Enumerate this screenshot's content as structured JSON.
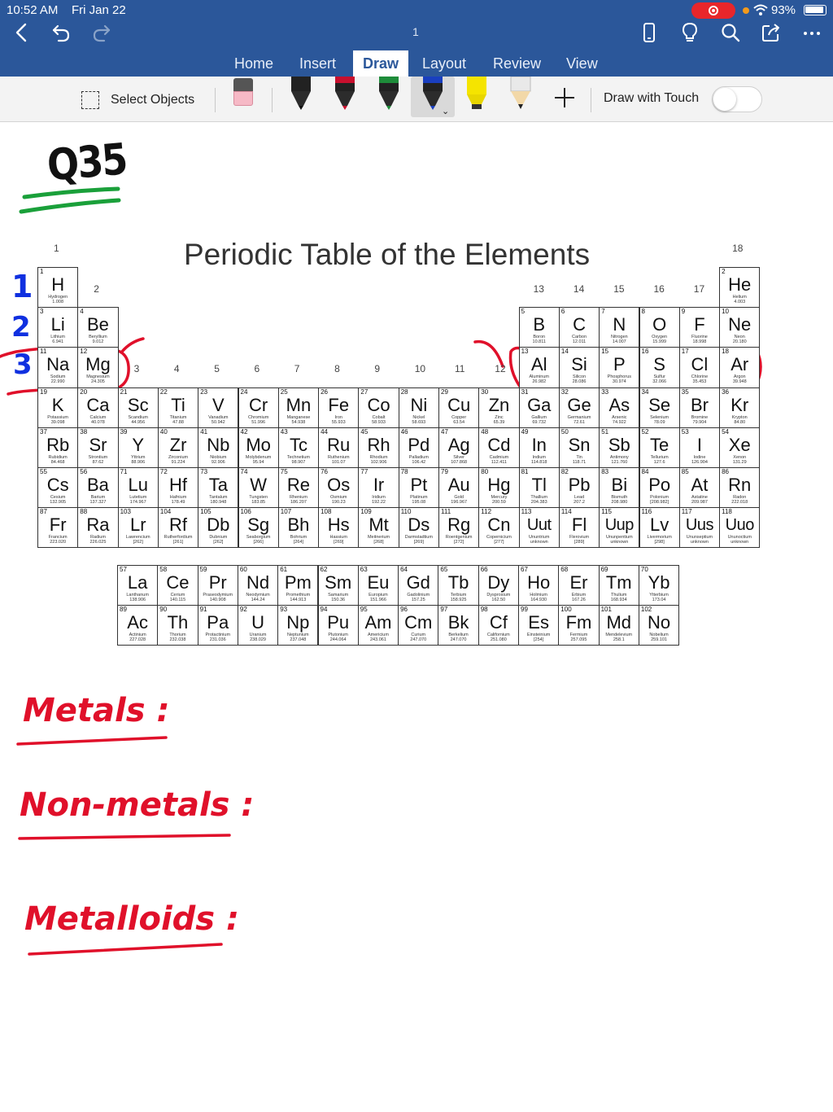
{
  "status_bar": {
    "time": "10:52 AM",
    "date": "Fri Jan 22",
    "battery": "93%"
  },
  "toolbar": {
    "page_number": "1"
  },
  "tabs": [
    {
      "label": "Home"
    },
    {
      "label": "Insert"
    },
    {
      "label": "Draw"
    },
    {
      "label": "Layout"
    },
    {
      "label": "Review"
    },
    {
      "label": "View"
    }
  ],
  "ribbon": {
    "select_objects_label": "Select Objects",
    "draw_with_touch_label": "Draw with Touch",
    "pens": [
      {
        "name": "black-pen",
        "color": "#1a1a1a"
      },
      {
        "name": "red-pen",
        "color": "#c8102e"
      },
      {
        "name": "green-pen",
        "color": "#1e8c3a"
      },
      {
        "name": "blue-pen",
        "color": "#1a3fbf"
      },
      {
        "name": "yellow-highlighter",
        "color": "#f5e400"
      },
      {
        "name": "pencil",
        "color": "#222222"
      }
    ]
  },
  "document": {
    "question_label": "Q35",
    "table_title": "Periodic Table of the Elements",
    "group_numbers": [
      "1",
      "2",
      "3",
      "4",
      "5",
      "6",
      "7",
      "8",
      "9",
      "10",
      "11",
      "12",
      "13",
      "14",
      "15",
      "16",
      "17",
      "18"
    ],
    "period_annotations": [
      "1",
      "2",
      "3"
    ],
    "categories": [
      "Metals :",
      "Non-metals :",
      "Metalloids :"
    ],
    "colors": {
      "accent": "#2b579a",
      "ink_red": "#e0102a",
      "ink_blue": "#1030e0",
      "ink_green": "#1aa03a"
    }
  },
  "elements": [
    {
      "n": "1",
      "s": "H",
      "name": "Hydrogen",
      "m": "1.008",
      "col": 1,
      "row": 1
    },
    {
      "n": "2",
      "s": "He",
      "name": "Helium",
      "m": "4.003",
      "col": 18,
      "row": 1
    },
    {
      "n": "3",
      "s": "Li",
      "name": "Lithium",
      "m": "6.941",
      "col": 1,
      "row": 2
    },
    {
      "n": "4",
      "s": "Be",
      "name": "Beryllium",
      "m": "9.012",
      "col": 2,
      "row": 2
    },
    {
      "n": "5",
      "s": "B",
      "name": "Boron",
      "m": "10.811",
      "col": 13,
      "row": 2
    },
    {
      "n": "6",
      "s": "C",
      "name": "Carbon",
      "m": "12.011",
      "col": 14,
      "row": 2
    },
    {
      "n": "7",
      "s": "N",
      "name": "Nitrogen",
      "m": "14.007",
      "col": 15,
      "row": 2
    },
    {
      "n": "8",
      "s": "O",
      "name": "Oxygen",
      "m": "15.999",
      "col": 16,
      "row": 2
    },
    {
      "n": "9",
      "s": "F",
      "name": "Fluorine",
      "m": "18.998",
      "col": 17,
      "row": 2
    },
    {
      "n": "10",
      "s": "Ne",
      "name": "Neon",
      "m": "20.180",
      "col": 18,
      "row": 2
    },
    {
      "n": "11",
      "s": "Na",
      "name": "Sodium",
      "m": "22.990",
      "col": 1,
      "row": 3
    },
    {
      "n": "12",
      "s": "Mg",
      "name": "Magnesium",
      "m": "24.305",
      "col": 2,
      "row": 3
    },
    {
      "n": "13",
      "s": "Al",
      "name": "Aluminum",
      "m": "26.982",
      "col": 13,
      "row": 3
    },
    {
      "n": "14",
      "s": "Si",
      "name": "Silicon",
      "m": "28.086",
      "col": 14,
      "row": 3
    },
    {
      "n": "15",
      "s": "P",
      "name": "Phosphorus",
      "m": "30.974",
      "col": 15,
      "row": 3
    },
    {
      "n": "16",
      "s": "S",
      "name": "Sulfur",
      "m": "32.066",
      "col": 16,
      "row": 3
    },
    {
      "n": "17",
      "s": "Cl",
      "name": "Chlorine",
      "m": "35.453",
      "col": 17,
      "row": 3
    },
    {
      "n": "18",
      "s": "Ar",
      "name": "Argon",
      "m": "39.948",
      "col": 18,
      "row": 3
    },
    {
      "n": "19",
      "s": "K",
      "name": "Potassium",
      "m": "39.098",
      "col": 1,
      "row": 4
    },
    {
      "n": "20",
      "s": "Ca",
      "name": "Calcium",
      "m": "40.078",
      "col": 2,
      "row": 4
    },
    {
      "n": "21",
      "s": "Sc",
      "name": "Scandium",
      "m": "44.956",
      "col": 3,
      "row": 4
    },
    {
      "n": "22",
      "s": "Ti",
      "name": "Titanium",
      "m": "47.88",
      "col": 4,
      "row": 4
    },
    {
      "n": "23",
      "s": "V",
      "name": "Vanadium",
      "m": "50.942",
      "col": 5,
      "row": 4
    },
    {
      "n": "24",
      "s": "Cr",
      "name": "Chromium",
      "m": "51.996",
      "col": 6,
      "row": 4
    },
    {
      "n": "25",
      "s": "Mn",
      "name": "Manganese",
      "m": "54.938",
      "col": 7,
      "row": 4
    },
    {
      "n": "26",
      "s": "Fe",
      "name": "Iron",
      "m": "55.933",
      "col": 8,
      "row": 4
    },
    {
      "n": "27",
      "s": "Co",
      "name": "Cobalt",
      "m": "58.933",
      "col": 9,
      "row": 4
    },
    {
      "n": "28",
      "s": "Ni",
      "name": "Nickel",
      "m": "58.693",
      "col": 10,
      "row": 4
    },
    {
      "n": "29",
      "s": "Cu",
      "name": "Copper",
      "m": "63.54",
      "col": 11,
      "row": 4
    },
    {
      "n": "30",
      "s": "Zn",
      "name": "Zinc",
      "m": "65.39",
      "col": 12,
      "row": 4
    },
    {
      "n": "31",
      "s": "Ga",
      "name": "Gallium",
      "m": "69.732",
      "col": 13,
      "row": 4
    },
    {
      "n": "32",
      "s": "Ge",
      "name": "Germanium",
      "m": "72.61",
      "col": 14,
      "row": 4
    },
    {
      "n": "33",
      "s": "As",
      "name": "Arsenic",
      "m": "74.922",
      "col": 15,
      "row": 4
    },
    {
      "n": "34",
      "s": "Se",
      "name": "Selenium",
      "m": "78.09",
      "col": 16,
      "row": 4
    },
    {
      "n": "35",
      "s": "Br",
      "name": "Bromine",
      "m": "79.904",
      "col": 17,
      "row": 4
    },
    {
      "n": "36",
      "s": "Kr",
      "name": "Krypton",
      "m": "84.80",
      "col": 18,
      "row": 4
    },
    {
      "n": "37",
      "s": "Rb",
      "name": "Rubidium",
      "m": "84.468",
      "col": 1,
      "row": 5
    },
    {
      "n": "38",
      "s": "Sr",
      "name": "Strontium",
      "m": "87.62",
      "col": 2,
      "row": 5
    },
    {
      "n": "39",
      "s": "Y",
      "name": "Yttrium",
      "m": "88.906",
      "col": 3,
      "row": 5
    },
    {
      "n": "40",
      "s": "Zr",
      "name": "Zirconium",
      "m": "91.224",
      "col": 4,
      "row": 5
    },
    {
      "n": "41",
      "s": "Nb",
      "name": "Niobium",
      "m": "92.906",
      "col": 5,
      "row": 5
    },
    {
      "n": "42",
      "s": "Mo",
      "name": "Molybdenum",
      "m": "95.94",
      "col": 6,
      "row": 5
    },
    {
      "n": "43",
      "s": "Tc",
      "name": "Technetium",
      "m": "98.907",
      "col": 7,
      "row": 5
    },
    {
      "n": "44",
      "s": "Ru",
      "name": "Ruthenium",
      "m": "101.07",
      "col": 8,
      "row": 5
    },
    {
      "n": "45",
      "s": "Rh",
      "name": "Rhodium",
      "m": "102.906",
      "col": 9,
      "row": 5
    },
    {
      "n": "46",
      "s": "Pd",
      "name": "Palladium",
      "m": "106.42",
      "col": 10,
      "row": 5
    },
    {
      "n": "47",
      "s": "Ag",
      "name": "Silver",
      "m": "107.868",
      "col": 11,
      "row": 5
    },
    {
      "n": "48",
      "s": "Cd",
      "name": "Cadmium",
      "m": "112.411",
      "col": 12,
      "row": 5
    },
    {
      "n": "49",
      "s": "In",
      "name": "Indium",
      "m": "114.818",
      "col": 13,
      "row": 5
    },
    {
      "n": "50",
      "s": "Sn",
      "name": "Tin",
      "m": "118.71",
      "col": 14,
      "row": 5
    },
    {
      "n": "51",
      "s": "Sb",
      "name": "Antimony",
      "m": "121.760",
      "col": 15,
      "row": 5
    },
    {
      "n": "52",
      "s": "Te",
      "name": "Tellurium",
      "m": "127.6",
      "col": 16,
      "row": 5
    },
    {
      "n": "53",
      "s": "I",
      "name": "Iodine",
      "m": "126.904",
      "col": 17,
      "row": 5
    },
    {
      "n": "54",
      "s": "Xe",
      "name": "Xenon",
      "m": "131.29",
      "col": 18,
      "row": 5
    },
    {
      "n": "55",
      "s": "Cs",
      "name": "Cesium",
      "m": "132.905",
      "col": 1,
      "row": 6
    },
    {
      "n": "56",
      "s": "Ba",
      "name": "Barium",
      "m": "137.327",
      "col": 2,
      "row": 6
    },
    {
      "n": "71",
      "s": "Lu",
      "name": "Lutetium",
      "m": "174.967",
      "col": 3,
      "row": 6
    },
    {
      "n": "72",
      "s": "Hf",
      "name": "Hafnium",
      "m": "178.49",
      "col": 4,
      "row": 6
    },
    {
      "n": "73",
      "s": "Ta",
      "name": "Tantalum",
      "m": "180.948",
      "col": 5,
      "row": 6
    },
    {
      "n": "74",
      "s": "W",
      "name": "Tungsten",
      "m": "183.85",
      "col": 6,
      "row": 6
    },
    {
      "n": "75",
      "s": "Re",
      "name": "Rhenium",
      "m": "186.207",
      "col": 7,
      "row": 6
    },
    {
      "n": "76",
      "s": "Os",
      "name": "Osmium",
      "m": "190.23",
      "col": 8,
      "row": 6
    },
    {
      "n": "77",
      "s": "Ir",
      "name": "Iridium",
      "m": "192.22",
      "col": 9,
      "row": 6
    },
    {
      "n": "78",
      "s": "Pt",
      "name": "Platinum",
      "m": "195.08",
      "col": 10,
      "row": 6
    },
    {
      "n": "79",
      "s": "Au",
      "name": "Gold",
      "m": "196.967",
      "col": 11,
      "row": 6
    },
    {
      "n": "80",
      "s": "Hg",
      "name": "Mercury",
      "m": "200.59",
      "col": 12,
      "row": 6
    },
    {
      "n": "81",
      "s": "Tl",
      "name": "Thallium",
      "m": "204.383",
      "col": 13,
      "row": 6
    },
    {
      "n": "82",
      "s": "Pb",
      "name": "Lead",
      "m": "207.2",
      "col": 14,
      "row": 6
    },
    {
      "n": "83",
      "s": "Bi",
      "name": "Bismuth",
      "m": "208.980",
      "col": 15,
      "row": 6
    },
    {
      "n": "84",
      "s": "Po",
      "name": "Polonium",
      "m": "[208.982]",
      "col": 16,
      "row": 6
    },
    {
      "n": "85",
      "s": "At",
      "name": "Astatine",
      "m": "209.987",
      "col": 17,
      "row": 6
    },
    {
      "n": "86",
      "s": "Rn",
      "name": "Radon",
      "m": "222.018",
      "col": 18,
      "row": 6
    },
    {
      "n": "87",
      "s": "Fr",
      "name": "Francium",
      "m": "223.020",
      "col": 1,
      "row": 7
    },
    {
      "n": "88",
      "s": "Ra",
      "name": "Radium",
      "m": "226.025",
      "col": 2,
      "row": 7
    },
    {
      "n": "103",
      "s": "Lr",
      "name": "Lawrencium",
      "m": "[262]",
      "col": 3,
      "row": 7
    },
    {
      "n": "104",
      "s": "Rf",
      "name": "Rutherfordium",
      "m": "[261]",
      "col": 4,
      "row": 7
    },
    {
      "n": "105",
      "s": "Db",
      "name": "Dubnium",
      "m": "[262]",
      "col": 5,
      "row": 7
    },
    {
      "n": "106",
      "s": "Sg",
      "name": "Seaborgium",
      "m": "[266]",
      "col": 6,
      "row": 7
    },
    {
      "n": "107",
      "s": "Bh",
      "name": "Bohrium",
      "m": "[264]",
      "col": 7,
      "row": 7
    },
    {
      "n": "108",
      "s": "Hs",
      "name": "Hassium",
      "m": "[269]",
      "col": 8,
      "row": 7
    },
    {
      "n": "109",
      "s": "Mt",
      "name": "Meitnerium",
      "m": "[268]",
      "col": 9,
      "row": 7
    },
    {
      "n": "110",
      "s": "Ds",
      "name": "Darmstadtium",
      "m": "[269]",
      "col": 10,
      "row": 7
    },
    {
      "n": "111",
      "s": "Rg",
      "name": "Roentgenium",
      "m": "[272]",
      "col": 11,
      "row": 7
    },
    {
      "n": "112",
      "s": "Cn",
      "name": "Copernicium",
      "m": "[277]",
      "col": 12,
      "row": 7
    },
    {
      "n": "113",
      "s": "Uut",
      "name": "Ununtrium",
      "m": "unknown",
      "col": 13,
      "row": 7
    },
    {
      "n": "114",
      "s": "Fl",
      "name": "Flerovium",
      "m": "[289]",
      "col": 14,
      "row": 7
    },
    {
      "n": "115",
      "s": "Uup",
      "name": "Ununpentium",
      "m": "unknown",
      "col": 15,
      "row": 7
    },
    {
      "n": "116",
      "s": "Lv",
      "name": "Livermorium",
      "m": "[298]",
      "col": 16,
      "row": 7
    },
    {
      "n": "117",
      "s": "Uus",
      "name": "Ununseptium",
      "m": "unknown",
      "col": 17,
      "row": 7
    },
    {
      "n": "118",
      "s": "Uuo",
      "name": "Ununoctium",
      "m": "unknown",
      "col": 18,
      "row": 7
    }
  ],
  "f_block": [
    {
      "n": "57",
      "s": "La",
      "name": "Lanthanum",
      "m": "138.906",
      "col": 1,
      "row": 1
    },
    {
      "n": "58",
      "s": "Ce",
      "name": "Cerium",
      "m": "140.115",
      "col": 2,
      "row": 1
    },
    {
      "n": "59",
      "s": "Pr",
      "name": "Praseodymium",
      "m": "140.908",
      "col": 3,
      "row": 1
    },
    {
      "n": "60",
      "s": "Nd",
      "name": "Neodymium",
      "m": "144.24",
      "col": 4,
      "row": 1
    },
    {
      "n": "61",
      "s": "Pm",
      "name": "Promethium",
      "m": "144.913",
      "col": 5,
      "row": 1
    },
    {
      "n": "62",
      "s": "Sm",
      "name": "Samarium",
      "m": "150.36",
      "col": 6,
      "row": 1
    },
    {
      "n": "63",
      "s": "Eu",
      "name": "Europium",
      "m": "151.966",
      "col": 7,
      "row": 1
    },
    {
      "n": "64",
      "s": "Gd",
      "name": "Gadolinium",
      "m": "157.25",
      "col": 8,
      "row": 1
    },
    {
      "n": "65",
      "s": "Tb",
      "name": "Terbium",
      "m": "158.925",
      "col": 9,
      "row": 1
    },
    {
      "n": "66",
      "s": "Dy",
      "name": "Dysprosium",
      "m": "162.50",
      "col": 10,
      "row": 1
    },
    {
      "n": "67",
      "s": "Ho",
      "name": "Holmium",
      "m": "164.930",
      "col": 11,
      "row": 1
    },
    {
      "n": "68",
      "s": "Er",
      "name": "Erbium",
      "m": "167.26",
      "col": 12,
      "row": 1
    },
    {
      "n": "69",
      "s": "Tm",
      "name": "Thulium",
      "m": "168.934",
      "col": 13,
      "row": 1
    },
    {
      "n": "70",
      "s": "Yb",
      "name": "Ytterbium",
      "m": "173.04",
      "col": 14,
      "row": 1
    },
    {
      "n": "89",
      "s": "Ac",
      "name": "Actinium",
      "m": "227.028",
      "col": 1,
      "row": 2
    },
    {
      "n": "90",
      "s": "Th",
      "name": "Thorium",
      "m": "232.038",
      "col": 2,
      "row": 2
    },
    {
      "n": "91",
      "s": "Pa",
      "name": "Protactinium",
      "m": "231.036",
      "col": 3,
      "row": 2
    },
    {
      "n": "92",
      "s": "U",
      "name": "Uranium",
      "m": "238.029",
      "col": 4,
      "row": 2
    },
    {
      "n": "93",
      "s": "Np",
      "name": "Neptunium",
      "m": "237.048",
      "col": 5,
      "row": 2
    },
    {
      "n": "94",
      "s": "Pu",
      "name": "Plutonium",
      "m": "244.064",
      "col": 6,
      "row": 2
    },
    {
      "n": "95",
      "s": "Am",
      "name": "Americium",
      "m": "243.061",
      "col": 7,
      "row": 2
    },
    {
      "n": "96",
      "s": "Cm",
      "name": "Curium",
      "m": "247.070",
      "col": 8,
      "row": 2
    },
    {
      "n": "97",
      "s": "Bk",
      "name": "Berkelium",
      "m": "247.070",
      "col": 9,
      "row": 2
    },
    {
      "n": "98",
      "s": "Cf",
      "name": "Californium",
      "m": "251.080",
      "col": 10,
      "row": 2
    },
    {
      "n": "99",
      "s": "Es",
      "name": "Einsteinium",
      "m": "[254]",
      "col": 11,
      "row": 2
    },
    {
      "n": "100",
      "s": "Fm",
      "name": "Fermium",
      "m": "257.095",
      "col": 12,
      "row": 2
    },
    {
      "n": "101",
      "s": "Md",
      "name": "Mendelevium",
      "m": "258.1",
      "col": 13,
      "row": 2
    },
    {
      "n": "102",
      "s": "No",
      "name": "Nobelium",
      "m": "259.101",
      "col": 14,
      "row": 2
    }
  ]
}
